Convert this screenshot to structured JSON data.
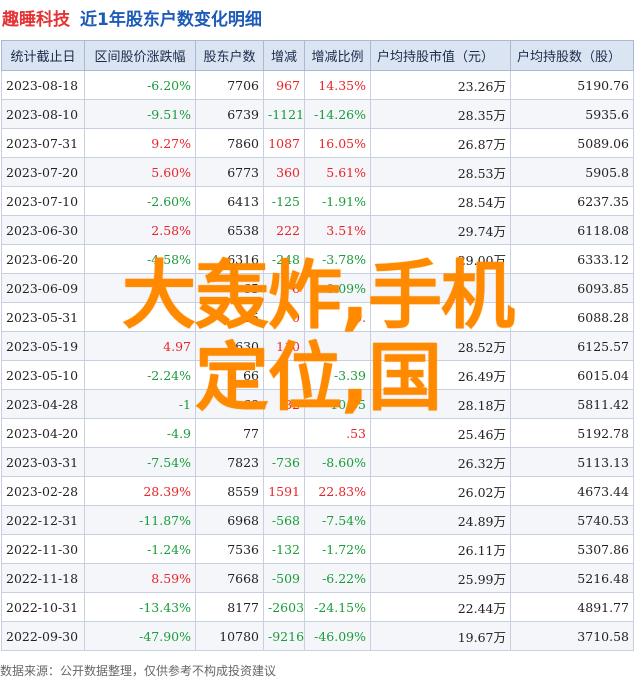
{
  "title": {
    "company": "趣睡科技",
    "main": "近1年股东户数变化明细"
  },
  "columns": [
    "统计截止日",
    "区间股价涨跌幅",
    "股东户数",
    "增减",
    "增减比例",
    "户均持股市值（元）",
    "户均持股数（股）"
  ],
  "rows": [
    {
      "date": "2023-08-18",
      "change": "-6.20%",
      "holders": "7706",
      "delta": "967",
      "delta_pct": "14.35%",
      "avg_value": "23.26万",
      "avg_shares": "5190.76"
    },
    {
      "date": "2023-08-10",
      "change": "-9.51%",
      "holders": "6739",
      "delta": "-1121",
      "delta_pct": "-14.26%",
      "avg_value": "28.35万",
      "avg_shares": "5935.6"
    },
    {
      "date": "2023-07-31",
      "change": "9.27%",
      "holders": "7860",
      "delta": "1087",
      "delta_pct": "16.05%",
      "avg_value": "26.87万",
      "avg_shares": "5089.06"
    },
    {
      "date": "2023-07-20",
      "change": "5.60%",
      "holders": "6773",
      "delta": "360",
      "delta_pct": "5.61%",
      "avg_value": "28.53万",
      "avg_shares": "5905.8"
    },
    {
      "date": "2023-07-10",
      "change": "-2.60%",
      "holders": "6413",
      "delta": "-125",
      "delta_pct": "-1.91%",
      "avg_value": "28.54万",
      "avg_shares": "6237.35"
    },
    {
      "date": "2023-06-30",
      "change": "2.58%",
      "holders": "6538",
      "delta": "222",
      "delta_pct": "3.51%",
      "avg_value": "29.74万",
      "avg_shares": "6118.08"
    },
    {
      "date": "2023-06-20",
      "change": "-4.58%",
      "holders": "6316",
      "delta": "-248",
      "delta_pct": "-3.78%",
      "avg_value": "29.00万",
      "avg_shares": "6333.12"
    },
    {
      "date": "2023-06-09",
      "change": "",
      "holders": "65",
      "delta": "6",
      "delta_pct": "-0.09%",
      "avg_value": "",
      "avg_shares": "6093.85"
    },
    {
      "date": "2023-05-31",
      "change": "",
      "holders": "65",
      "delta": "0",
      "delta_pct": "0.",
      "avg_value": "",
      "avg_shares": "6088.28"
    },
    {
      "date": "2023-05-19",
      "change": "4.97",
      "holders": "6630",
      "delta": "110",
      "delta_pct": "",
      "avg_value": "28.52万",
      "avg_shares": "6125.57"
    },
    {
      "date": "2023-05-10",
      "change": "-2.24%",
      "holders": "66",
      "delta": "",
      "delta_pct": "-3.39",
      "avg_value": "26.49万",
      "avg_shares": "6015.04"
    },
    {
      "date": "2023-04-28",
      "change": "-1",
      "holders": "68",
      "delta": "82",
      "delta_pct": "-10.65",
      "avg_value": "28.18万",
      "avg_shares": "5811.42"
    },
    {
      "date": "2023-04-20",
      "change": "-4.9",
      "holders": "77",
      "delta": "",
      "delta_pct": ".53",
      "avg_value": "25.46万",
      "avg_shares": "5192.78"
    },
    {
      "date": "2023-03-31",
      "change": "-7.54%",
      "holders": "7823",
      "delta": "-736",
      "delta_pct": "-8.60%",
      "avg_value": "26.32万",
      "avg_shares": "5113.13"
    },
    {
      "date": "2023-02-28",
      "change": "28.39%",
      "holders": "8559",
      "delta": "1591",
      "delta_pct": "22.83%",
      "avg_value": "26.02万",
      "avg_shares": "4673.44"
    },
    {
      "date": "2022-12-31",
      "change": "-11.87%",
      "holders": "6968",
      "delta": "-568",
      "delta_pct": "-7.54%",
      "avg_value": "24.89万",
      "avg_shares": "5740.53"
    },
    {
      "date": "2022-11-30",
      "change": "-1.24%",
      "holders": "7536",
      "delta": "-132",
      "delta_pct": "-1.72%",
      "avg_value": "26.11万",
      "avg_shares": "5307.86"
    },
    {
      "date": "2022-11-18",
      "change": "8.59%",
      "holders": "7668",
      "delta": "-509",
      "delta_pct": "-6.22%",
      "avg_value": "25.99万",
      "avg_shares": "5216.48"
    },
    {
      "date": "2022-10-31",
      "change": "-13.43%",
      "holders": "8177",
      "delta": "-2603",
      "delta_pct": "-24.15%",
      "avg_value": "22.44万",
      "avg_shares": "4891.77"
    },
    {
      "date": "2022-09-30",
      "change": "-47.90%",
      "holders": "10780",
      "delta": "-9216",
      "delta_pct": "-46.09%",
      "avg_value": "19.67万",
      "avg_shares": "3710.58"
    }
  ],
  "overlay": {
    "line1": "大轰炸,手机",
    "line2": "定位,国"
  },
  "footer": "数据来源：公开数据整理，仅供参考不构成投资建议",
  "colors": {
    "positive": "#e8262a",
    "negative": "#1a9c3a",
    "header_bg": "#dbe4f3",
    "overlay": "#ff8a00",
    "title_company": "#e53333",
    "title_main": "#1e5bb8"
  }
}
